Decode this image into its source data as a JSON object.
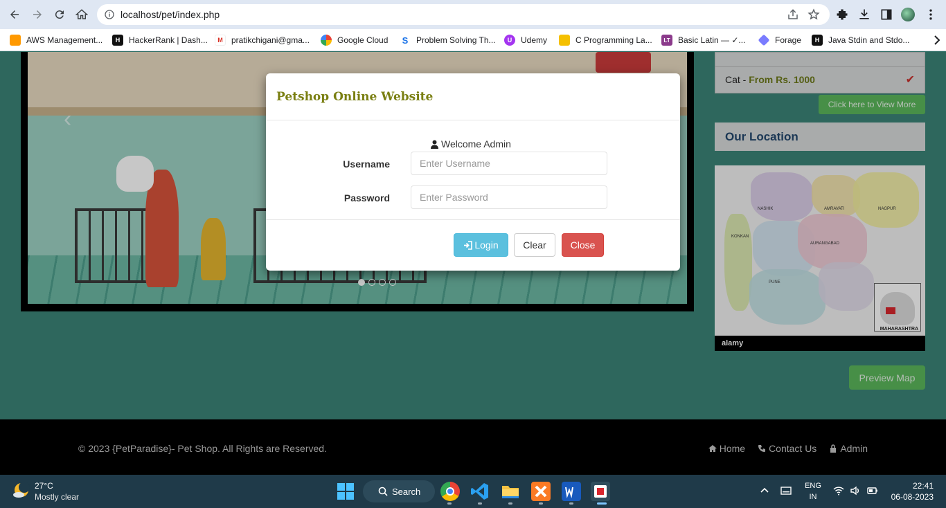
{
  "browser": {
    "url": "localhost/pet/index.php",
    "bookmarks": [
      {
        "label": "AWS Management...",
        "color": "#ff9900",
        "glyph": ""
      },
      {
        "label": "HackerRank | Dash...",
        "color": "#111111",
        "glyph": "H"
      },
      {
        "label": "pratikchigani@gma...",
        "color": "#ffffff",
        "glyph": "M"
      },
      {
        "label": "Google Cloud",
        "color": "#4285f4",
        "glyph": ""
      },
      {
        "label": "Problem Solving Th...",
        "color": "#ffffff",
        "glyph": "S"
      },
      {
        "label": "Udemy",
        "color": "#a435f0",
        "glyph": "U"
      },
      {
        "label": "C Programming La...",
        "color": "#f5c000",
        "glyph": ""
      },
      {
        "label": "Basic Latin — ✓...",
        "color": "#8b3a8b",
        "glyph": "LT"
      },
      {
        "label": "Forage",
        "color": "#7a7cff",
        "glyph": ""
      },
      {
        "label": "Java Stdin and Stdo...",
        "color": "#111111",
        "glyph": "H"
      }
    ]
  },
  "side": {
    "list_item_name": "Cat",
    "list_item_sep": " - ",
    "list_item_price": "From Rs. 1000",
    "view_more_label": "Click here to View More",
    "location_heading": "Our Location",
    "map": {
      "region_labels": [
        "NASHIK",
        "AMRAVATI",
        "NAGPUR",
        "KONKAN",
        "AURANGABAD",
        "PUNE"
      ],
      "state_label": "MAHARASHTRA",
      "watermark": "alamy"
    },
    "preview_map_label": "Preview Map"
  },
  "modal": {
    "title": "Petshop Online Website",
    "welcome": "Welcome Admin",
    "username_label": "Username",
    "username_placeholder": "Enter Username",
    "password_label": "Password",
    "password_placeholder": "Enter Password",
    "login_label": "Login",
    "clear_label": "Clear",
    "close_label": "Close"
  },
  "footer": {
    "copyright": "© 2023 {PetParadise}- Pet Shop. All Rights are Reserved.",
    "links": [
      "Home",
      "Contact Us",
      "Admin"
    ]
  },
  "taskbar": {
    "temperature": "27°C",
    "weather": "Mostly clear",
    "search_label": "Search",
    "lang_top": "ENG",
    "lang_bottom": "IN",
    "time": "22:41",
    "date": "06-08-2023"
  },
  "colors": {
    "modal_title": "#7a7f12",
    "login_button": "#5bc0de",
    "close_button": "#d9534f",
    "success_button": "#5cb85c",
    "heading_blue": "#24486e"
  }
}
